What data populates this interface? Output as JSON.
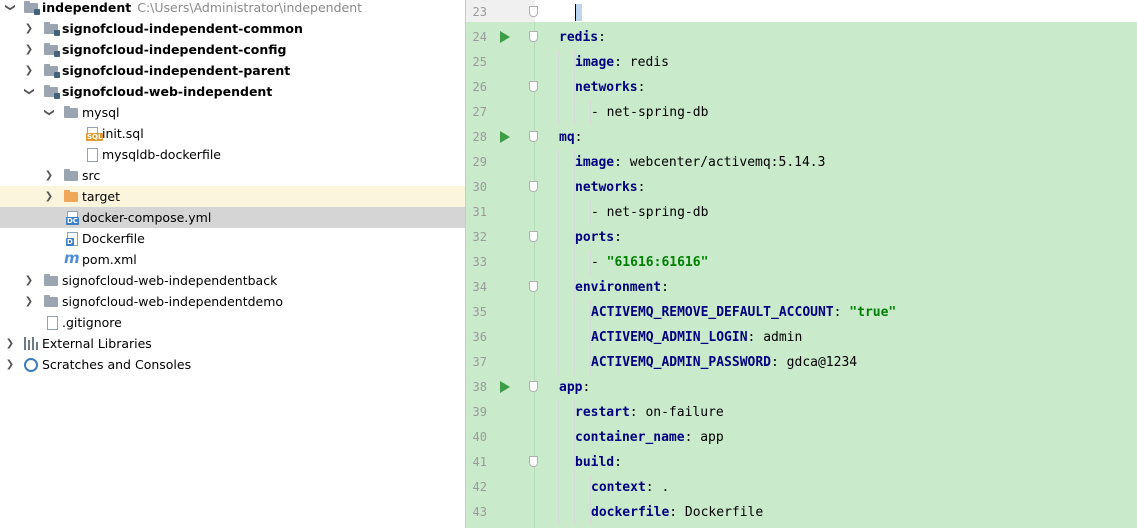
{
  "tree": {
    "root": {
      "label": "independent",
      "path": "C:\\Users\\Administrator\\independent"
    },
    "items": [
      {
        "label": "signofcloud-independent-common"
      },
      {
        "label": "signofcloud-independent-config"
      },
      {
        "label": "signofcloud-independent-parent"
      },
      {
        "label": "signofcloud-web-independent"
      },
      {
        "label": "mysql"
      },
      {
        "label": "init.sql"
      },
      {
        "label": "mysqldb-dockerfile"
      },
      {
        "label": "src"
      },
      {
        "label": "target"
      },
      {
        "label": "docker-compose.yml"
      },
      {
        "label": "Dockerfile"
      },
      {
        "label": "pom.xml"
      },
      {
        "label": "signofcloud-web-independentback"
      },
      {
        "label": "signofcloud-web-independentdemo"
      },
      {
        "label": ".gitignore"
      },
      {
        "label": "External Libraries"
      },
      {
        "label": "Scratches and Consoles"
      }
    ]
  },
  "editor": {
    "lines": [
      {
        "n": "23",
        "parts": []
      },
      {
        "n": "24",
        "parts": [
          [
            "k",
            "redis"
          ],
          [
            "p",
            ":"
          ]
        ]
      },
      {
        "n": "25",
        "parts": [
          [
            "k",
            "image"
          ],
          [
            "p",
            ": redis"
          ]
        ]
      },
      {
        "n": "26",
        "parts": [
          [
            "k",
            "networks"
          ],
          [
            "p",
            ":"
          ]
        ]
      },
      {
        "n": "27",
        "parts": [
          [
            "p",
            "- net-spring-db"
          ]
        ]
      },
      {
        "n": "28",
        "parts": [
          [
            "k",
            "mq"
          ],
          [
            "p",
            ":"
          ]
        ]
      },
      {
        "n": "29",
        "parts": [
          [
            "k",
            "image"
          ],
          [
            "p",
            ": webcenter/activemq:5.14.3"
          ]
        ]
      },
      {
        "n": "30",
        "parts": [
          [
            "k",
            "networks"
          ],
          [
            "p",
            ":"
          ]
        ]
      },
      {
        "n": "31",
        "parts": [
          [
            "p",
            "- net-spring-db"
          ]
        ]
      },
      {
        "n": "32",
        "parts": [
          [
            "k",
            "ports"
          ],
          [
            "p",
            ":"
          ]
        ]
      },
      {
        "n": "33",
        "parts": [
          [
            "p",
            "- "
          ],
          [
            "s",
            "\"61616:61616\""
          ]
        ]
      },
      {
        "n": "34",
        "parts": [
          [
            "k",
            "environment"
          ],
          [
            "p",
            ":"
          ]
        ]
      },
      {
        "n": "35",
        "parts": [
          [
            "k",
            "ACTIVEMQ_REMOVE_DEFAULT_ACCOUNT"
          ],
          [
            "p",
            ": "
          ],
          [
            "s",
            "\"true\""
          ]
        ]
      },
      {
        "n": "36",
        "parts": [
          [
            "k",
            "ACTIVEMQ_ADMIN_LOGIN"
          ],
          [
            "p",
            ": admin"
          ]
        ]
      },
      {
        "n": "37",
        "parts": [
          [
            "k",
            "ACTIVEMQ_ADMIN_PASSWORD"
          ],
          [
            "p",
            ": gdca@1234"
          ]
        ]
      },
      {
        "n": "38",
        "parts": [
          [
            "k",
            "app"
          ],
          [
            "p",
            ":"
          ]
        ]
      },
      {
        "n": "39",
        "parts": [
          [
            "k",
            "restart"
          ],
          [
            "p",
            ": on-failure"
          ]
        ]
      },
      {
        "n": "40",
        "parts": [
          [
            "k",
            "container_name"
          ],
          [
            "p",
            ": app"
          ]
        ]
      },
      {
        "n": "41",
        "parts": [
          [
            "k",
            "build"
          ],
          [
            "p",
            ":"
          ]
        ]
      },
      {
        "n": "42",
        "parts": [
          [
            "k",
            "context"
          ],
          [
            "p",
            ": ."
          ]
        ]
      },
      {
        "n": "43",
        "parts": [
          [
            "k",
            "dockerfile"
          ],
          [
            "p",
            ": Dockerfile"
          ]
        ]
      }
    ]
  },
  "colors": {
    "keyword": "#000080",
    "string": "#008000",
    "selected_row": "#d5d5d5",
    "highlight_row": "#fbf5dd",
    "diff_added": "#c9ebcc"
  }
}
